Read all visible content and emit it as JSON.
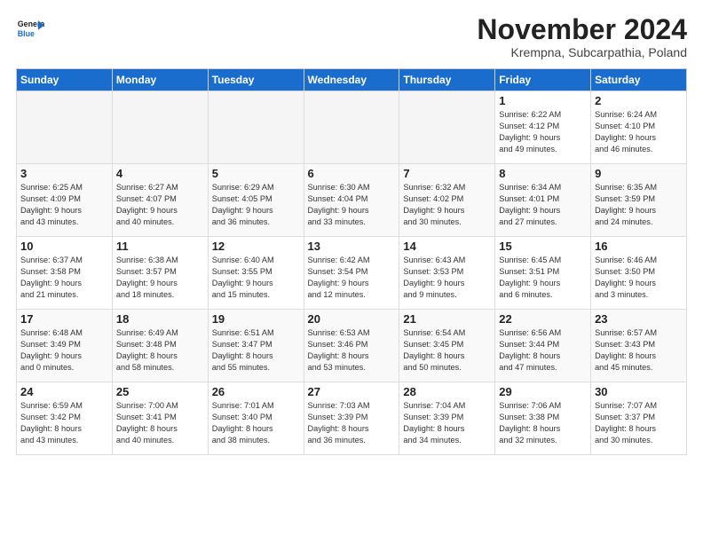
{
  "logo": {
    "general": "General",
    "blue": "Blue"
  },
  "title": "November 2024",
  "subtitle": "Krempna, Subcarpathia, Poland",
  "days_header": [
    "Sunday",
    "Monday",
    "Tuesday",
    "Wednesday",
    "Thursday",
    "Friday",
    "Saturday"
  ],
  "weeks": [
    [
      {
        "day": "",
        "info": ""
      },
      {
        "day": "",
        "info": ""
      },
      {
        "day": "",
        "info": ""
      },
      {
        "day": "",
        "info": ""
      },
      {
        "day": "",
        "info": ""
      },
      {
        "day": "1",
        "info": "Sunrise: 6:22 AM\nSunset: 4:12 PM\nDaylight: 9 hours\nand 49 minutes."
      },
      {
        "day": "2",
        "info": "Sunrise: 6:24 AM\nSunset: 4:10 PM\nDaylight: 9 hours\nand 46 minutes."
      }
    ],
    [
      {
        "day": "3",
        "info": "Sunrise: 6:25 AM\nSunset: 4:09 PM\nDaylight: 9 hours\nand 43 minutes."
      },
      {
        "day": "4",
        "info": "Sunrise: 6:27 AM\nSunset: 4:07 PM\nDaylight: 9 hours\nand 40 minutes."
      },
      {
        "day": "5",
        "info": "Sunrise: 6:29 AM\nSunset: 4:05 PM\nDaylight: 9 hours\nand 36 minutes."
      },
      {
        "day": "6",
        "info": "Sunrise: 6:30 AM\nSunset: 4:04 PM\nDaylight: 9 hours\nand 33 minutes."
      },
      {
        "day": "7",
        "info": "Sunrise: 6:32 AM\nSunset: 4:02 PM\nDaylight: 9 hours\nand 30 minutes."
      },
      {
        "day": "8",
        "info": "Sunrise: 6:34 AM\nSunset: 4:01 PM\nDaylight: 9 hours\nand 27 minutes."
      },
      {
        "day": "9",
        "info": "Sunrise: 6:35 AM\nSunset: 3:59 PM\nDaylight: 9 hours\nand 24 minutes."
      }
    ],
    [
      {
        "day": "10",
        "info": "Sunrise: 6:37 AM\nSunset: 3:58 PM\nDaylight: 9 hours\nand 21 minutes."
      },
      {
        "day": "11",
        "info": "Sunrise: 6:38 AM\nSunset: 3:57 PM\nDaylight: 9 hours\nand 18 minutes."
      },
      {
        "day": "12",
        "info": "Sunrise: 6:40 AM\nSunset: 3:55 PM\nDaylight: 9 hours\nand 15 minutes."
      },
      {
        "day": "13",
        "info": "Sunrise: 6:42 AM\nSunset: 3:54 PM\nDaylight: 9 hours\nand 12 minutes."
      },
      {
        "day": "14",
        "info": "Sunrise: 6:43 AM\nSunset: 3:53 PM\nDaylight: 9 hours\nand 9 minutes."
      },
      {
        "day": "15",
        "info": "Sunrise: 6:45 AM\nSunset: 3:51 PM\nDaylight: 9 hours\nand 6 minutes."
      },
      {
        "day": "16",
        "info": "Sunrise: 6:46 AM\nSunset: 3:50 PM\nDaylight: 9 hours\nand 3 minutes."
      }
    ],
    [
      {
        "day": "17",
        "info": "Sunrise: 6:48 AM\nSunset: 3:49 PM\nDaylight: 9 hours\nand 0 minutes."
      },
      {
        "day": "18",
        "info": "Sunrise: 6:49 AM\nSunset: 3:48 PM\nDaylight: 8 hours\nand 58 minutes."
      },
      {
        "day": "19",
        "info": "Sunrise: 6:51 AM\nSunset: 3:47 PM\nDaylight: 8 hours\nand 55 minutes."
      },
      {
        "day": "20",
        "info": "Sunrise: 6:53 AM\nSunset: 3:46 PM\nDaylight: 8 hours\nand 53 minutes."
      },
      {
        "day": "21",
        "info": "Sunrise: 6:54 AM\nSunset: 3:45 PM\nDaylight: 8 hours\nand 50 minutes."
      },
      {
        "day": "22",
        "info": "Sunrise: 6:56 AM\nSunset: 3:44 PM\nDaylight: 8 hours\nand 47 minutes."
      },
      {
        "day": "23",
        "info": "Sunrise: 6:57 AM\nSunset: 3:43 PM\nDaylight: 8 hours\nand 45 minutes."
      }
    ],
    [
      {
        "day": "24",
        "info": "Sunrise: 6:59 AM\nSunset: 3:42 PM\nDaylight: 8 hours\nand 43 minutes."
      },
      {
        "day": "25",
        "info": "Sunrise: 7:00 AM\nSunset: 3:41 PM\nDaylight: 8 hours\nand 40 minutes."
      },
      {
        "day": "26",
        "info": "Sunrise: 7:01 AM\nSunset: 3:40 PM\nDaylight: 8 hours\nand 38 minutes."
      },
      {
        "day": "27",
        "info": "Sunrise: 7:03 AM\nSunset: 3:39 PM\nDaylight: 8 hours\nand 36 minutes."
      },
      {
        "day": "28",
        "info": "Sunrise: 7:04 AM\nSunset: 3:39 PM\nDaylight: 8 hours\nand 34 minutes."
      },
      {
        "day": "29",
        "info": "Sunrise: 7:06 AM\nSunset: 3:38 PM\nDaylight: 8 hours\nand 32 minutes."
      },
      {
        "day": "30",
        "info": "Sunrise: 7:07 AM\nSunset: 3:37 PM\nDaylight: 8 hours\nand 30 minutes."
      }
    ]
  ]
}
